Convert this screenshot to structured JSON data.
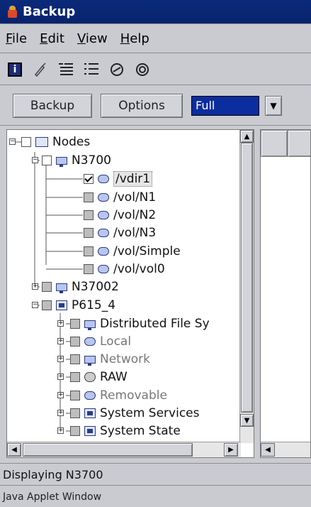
{
  "window": {
    "title": "Backup"
  },
  "menu": [
    {
      "mnemonic": "F",
      "rest": "ile"
    },
    {
      "mnemonic": "E",
      "rest": "dit"
    },
    {
      "mnemonic": "V",
      "rest": "iew"
    },
    {
      "mnemonic": "H",
      "rest": "elp"
    }
  ],
  "toolbar": {
    "icons": [
      "info-icon",
      "broom-icon",
      "expand-tree-icon",
      "collapse-tree-icon",
      "deselect-icon",
      "target-icon"
    ]
  },
  "actions": {
    "backup_label": "Backup",
    "options_label": "Options",
    "mode_value": "Full"
  },
  "tree": {
    "root": "Nodes",
    "n3700": "N3700",
    "vols": [
      "/vdir1",
      "/vol/N1",
      "/vol/N2",
      "/vol/N3",
      "/vol/Simple",
      "/vol/vol0"
    ],
    "n37002": "N37002",
    "p615": "P615_4",
    "p615_children": [
      "Distributed File Sy",
      "Local",
      "Network",
      "RAW",
      "Removable",
      "System Services",
      "System State"
    ]
  },
  "status": {
    "text": "Displaying N3700",
    "applet": "Java Applet Window"
  }
}
